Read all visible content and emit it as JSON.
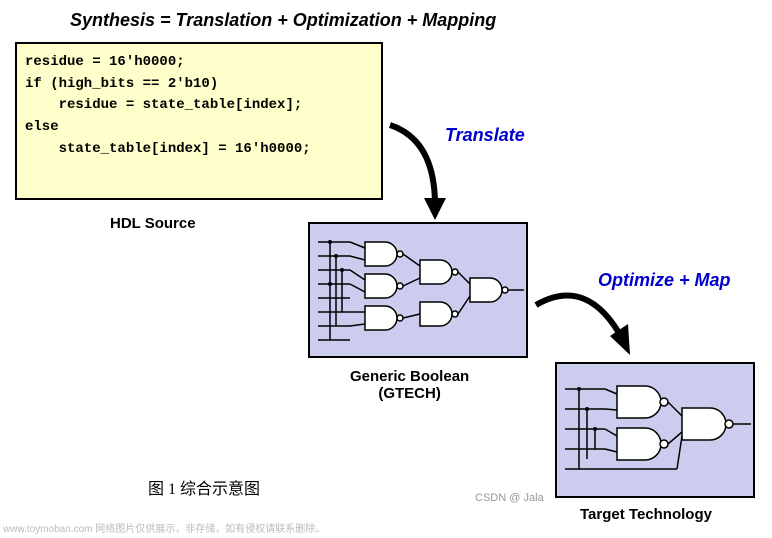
{
  "title": "Synthesis  =   Translation  +  Optimization  +  Mapping",
  "code": {
    "line1": "residue = 16'h0000;",
    "line2": "if (high_bits == 2'b10)",
    "line3": "    residue = state_table[index];",
    "line4": "else",
    "line5": "    state_table[index] = 16'h0000;"
  },
  "labels": {
    "hdl": "HDL Source",
    "translate": "Translate",
    "gtech_top": "Generic Boolean",
    "gtech_bottom": "(GTECH)",
    "optmap": "Optimize + Map",
    "target": "Target Technology"
  },
  "caption": "图 1 综合示意图",
  "watermark1": "www.toymoban.com  网络图片仅供展示，非存储，如有侵权请联系删除。",
  "watermark2": "CSDN @ Jala"
}
